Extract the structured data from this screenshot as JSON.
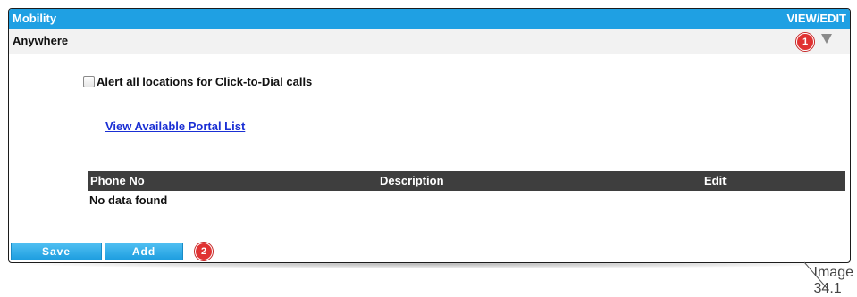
{
  "header": {
    "title": "Mobility",
    "view_edit": "VIEW/EDIT"
  },
  "section": {
    "title": "Anywhere",
    "marker": "1",
    "collapse_icon": "triangle-down"
  },
  "alert_checkbox": {
    "label": "Alert all locations for Click-to-Dial calls",
    "checked": false
  },
  "portal_link": "View Available Portal List",
  "table": {
    "columns": [
      "Phone No",
      "Description",
      "Edit"
    ],
    "empty_message": "No data found"
  },
  "buttons": {
    "save": "Save",
    "add": "Add"
  },
  "add_marker": "2",
  "caption": "Image 34.1",
  "colors": {
    "header_bg": "#1fa0e3",
    "table_header_bg": "#3e3e3e",
    "marker_bg": "#e03232",
    "link": "#1a2fd4",
    "button": "#1e9ee0"
  }
}
